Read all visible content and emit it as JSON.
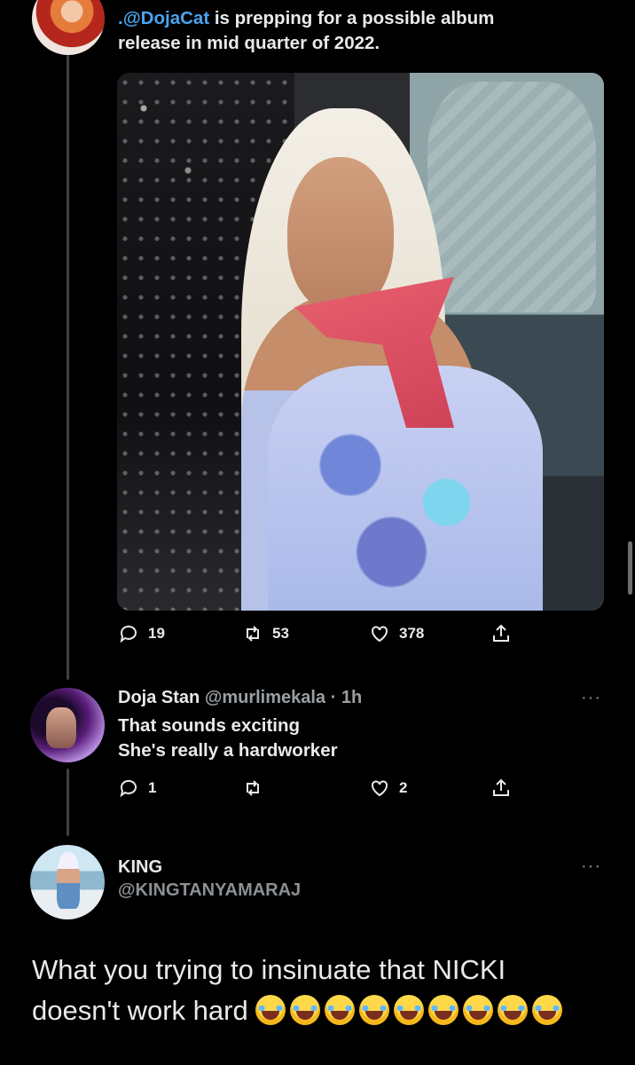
{
  "tweet1": {
    "mention": ".@DojaCat",
    "text_rest": " is prepping for a possible album",
    "text_line2": "release in mid quarter of 2022.",
    "replies": "19",
    "retweets": "53",
    "likes": "378"
  },
  "reply": {
    "display_name": "Doja Stan",
    "handle_time": "@murlimekala · 1h",
    "line1": "That sounds exciting",
    "line2": "She's really a hardworker",
    "replies": "1",
    "retweets": "",
    "likes": "2",
    "more": "···"
  },
  "tweet2": {
    "display_name": "KING",
    "handle": "@KINGTANYAMARAJ",
    "more": "···",
    "line1": "What you trying to insinuate that NICKI",
    "line2": "doesn't work hard",
    "emoji_name": "face-with-tears-of-joy",
    "emoji_count": 9
  },
  "colors": {
    "background": "#000000",
    "text": "#e7e9ea",
    "mention": "#4aa3ef",
    "muted": "#9a9fa4",
    "thread_line": "#3e4144"
  },
  "icons": [
    "reply-icon",
    "retweet-icon",
    "like-icon",
    "share-icon",
    "more-icon"
  ]
}
